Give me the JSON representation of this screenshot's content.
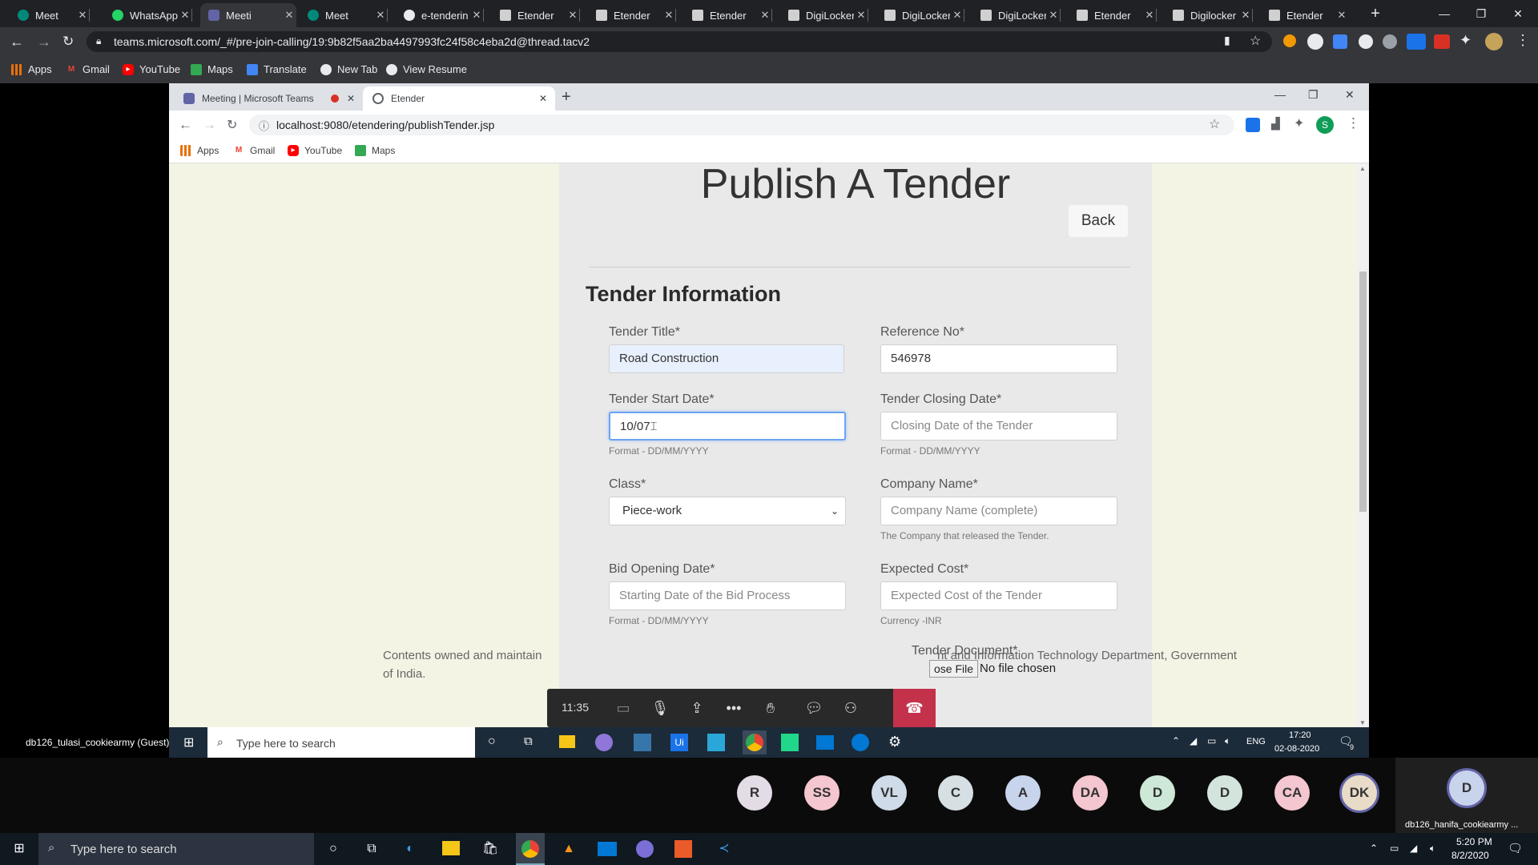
{
  "outer_browser": {
    "tabs": [
      {
        "title": "Meet",
        "icon": "meet-icon"
      },
      {
        "title": "WhatsApp",
        "icon": "whatsapp-icon"
      },
      {
        "title": "Meeti",
        "icon": "teams-icon"
      },
      {
        "title": "Meet",
        "icon": "meet-icon"
      },
      {
        "title": "e-tenderin",
        "icon": "github-icon"
      },
      {
        "title": "Etender",
        "icon": "doc-icon"
      },
      {
        "title": "Etender",
        "icon": "doc-icon"
      },
      {
        "title": "Etender",
        "icon": "doc-icon"
      },
      {
        "title": "DigiLocker",
        "icon": "doc-icon"
      },
      {
        "title": "DigiLocker",
        "icon": "doc-icon"
      },
      {
        "title": "DigiLocker",
        "icon": "doc-icon"
      },
      {
        "title": "Etender",
        "icon": "doc-icon"
      },
      {
        "title": "Digilocker",
        "icon": "doc-icon"
      },
      {
        "title": "Etender",
        "icon": "doc-icon"
      }
    ],
    "url": "teams.microsoft.com/_#/pre-join-calling/19:9b82f5aa2ba4497993fc24f58c4eba2d@thread.tacv2",
    "bookmarks": [
      "Apps",
      "Gmail",
      "YouTube",
      "Maps",
      "Translate",
      "New Tab",
      "View Resume"
    ]
  },
  "inner_browser": {
    "tabs": [
      {
        "title": "Meeting | Microsoft Teams"
      },
      {
        "title": "Etender"
      }
    ],
    "url": "localhost:9080/etendering/publishTender.jsp",
    "profile_initial": "S",
    "bookmarks": [
      "Apps",
      "Gmail",
      "YouTube",
      "Maps"
    ]
  },
  "page": {
    "heading": "Publish A Tender",
    "back_label": "Back",
    "section_title": "Tender Information",
    "fields": {
      "tender_title": {
        "label": "Tender Title*",
        "value": "Road Construction"
      },
      "reference_no": {
        "label": "Reference No*",
        "value": "546978"
      },
      "start_date": {
        "label": "Tender Start Date*",
        "value": "10/07",
        "help": "Format - DD/MM/YYYY"
      },
      "closing_date": {
        "label": "Tender Closing Date*",
        "placeholder": "Closing Date of the Tender",
        "help": "Format - DD/MM/YYYY"
      },
      "class": {
        "label": "Class*",
        "value": "Piece-work"
      },
      "company_name": {
        "label": "Company Name*",
        "placeholder": "Company Name (complete)",
        "help": "The Company that released the Tender."
      },
      "bid_opening_date": {
        "label": "Bid Opening Date*",
        "placeholder": "Starting Date of the Bid Process",
        "help": "Format - DD/MM/YYYY"
      },
      "expected_cost": {
        "label": "Expected Cost*",
        "placeholder": "Expected Cost of the Tender",
        "help": "Currency -INR"
      },
      "tender_document": {
        "label": "Tender Document*",
        "file_button": "ose File",
        "file_status": "No file chosen"
      }
    },
    "footer_left": "Contents owned and maintain",
    "footer_left2": "of India.",
    "footer_right": "nt and Information Technology Department, Government"
  },
  "call_bar": {
    "timer": "11:35"
  },
  "inner_taskbar": {
    "guest_name": "db126_tulasi_cookiearmy (Guest)",
    "search_placeholder": "Type here to search",
    "lang": "ENG",
    "time": "17:20",
    "date": "02-08-2020",
    "notif_count": "9"
  },
  "participants": [
    "R",
    "SS",
    "VL",
    "C",
    "A",
    "DA",
    "D",
    "D",
    "CA",
    "DK"
  ],
  "self_tile": {
    "initial": "D",
    "name": "db126_hanifa_cookiearmy ..."
  },
  "taskbar": {
    "search_placeholder": "Type here to search",
    "time": "5:20 PM",
    "date": "8/2/2020"
  },
  "colors": {
    "accent_blue": "#1a73e8",
    "hangup_red": "#c4314b",
    "page_bg": "#f4f4e4",
    "card_bg": "#e9e9e9"
  }
}
